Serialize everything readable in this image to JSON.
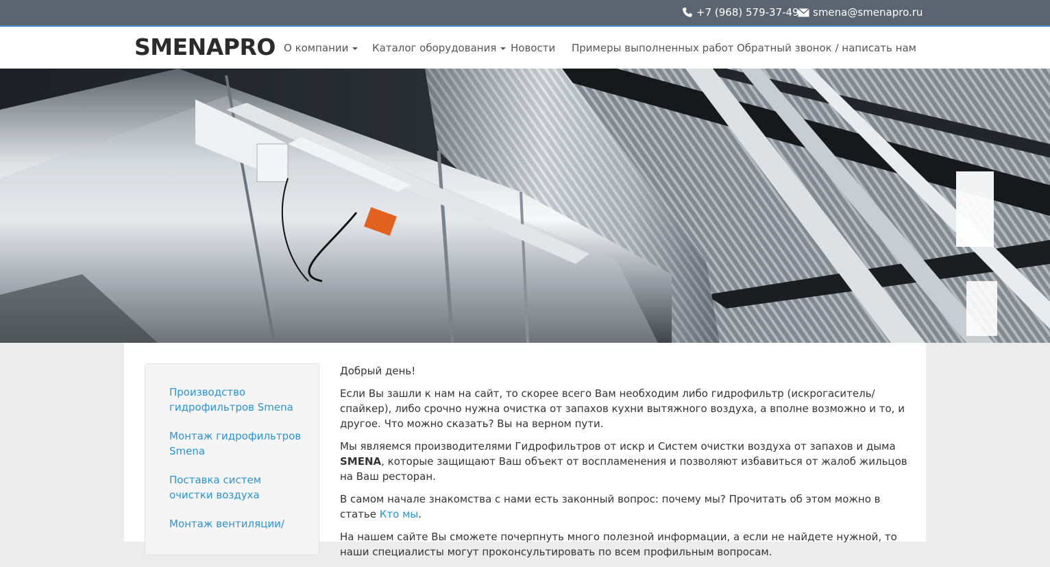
{
  "topbar": {
    "phone": "+7 (968) 579-37-49",
    "email": "smena@smenapro.ru",
    "phone_icon": "phone-icon",
    "email_icon": "envelope-icon"
  },
  "navbar": {
    "brand": "SMENAPRO",
    "items": [
      {
        "label": "О компании",
        "dropdown": true
      },
      {
        "label": "Каталог оборудования",
        "dropdown": true
      },
      {
        "label": "Новости",
        "dropdown": false
      },
      {
        "label": "Примеры выполненных работ",
        "dropdown": false
      },
      {
        "label": "Обратный звонок / написать нам",
        "dropdown": false
      }
    ]
  },
  "sidebar": {
    "links": [
      "Производство гидрофильтров Smena",
      "Монтаж гидрофильтров Smena",
      "Поставка систем очистки воздуха",
      "Монтаж вентиляции/"
    ]
  },
  "content": {
    "greeting": "Добрый день!",
    "p1": "Если Вы зашли к нам на сайт, то скорее всего Вам необходим либо гидрофильтр (искрогаситель/спайкер), либо срочно нужна очистка от запахов кухни вытяжного воздуха, а вполне возможно и то, и другое. Что можно сказать? Вы на верном пути.",
    "p2_before": "Мы являемся производителями Гидрофильтров от искр и Систем очистки воздуха от запахов и дыма ",
    "p2_bold": "SMENA",
    "p2_after": ", которые защищают Ваш объект от воспламенения и позволяют избавиться от жалоб жильцов на Ваш ресторан.",
    "p3_before": "В самом начале знакомства с нами есть законный вопрос: почему мы? Прочитать об этом можно в статье ",
    "p3_link": "Кто мы",
    "p3_after": ".",
    "p4": "На нашем сайте Вы сможете почерпнуть много полезной информации, а если не найдете нужной, то наши специалисты могут проконсультировать по всем профильным вопросам."
  },
  "colors": {
    "topbar_bg": "#5b6572",
    "topbar_border": "#3d8ed0",
    "link": "#2a93d5",
    "page_bg": "#ececec"
  }
}
